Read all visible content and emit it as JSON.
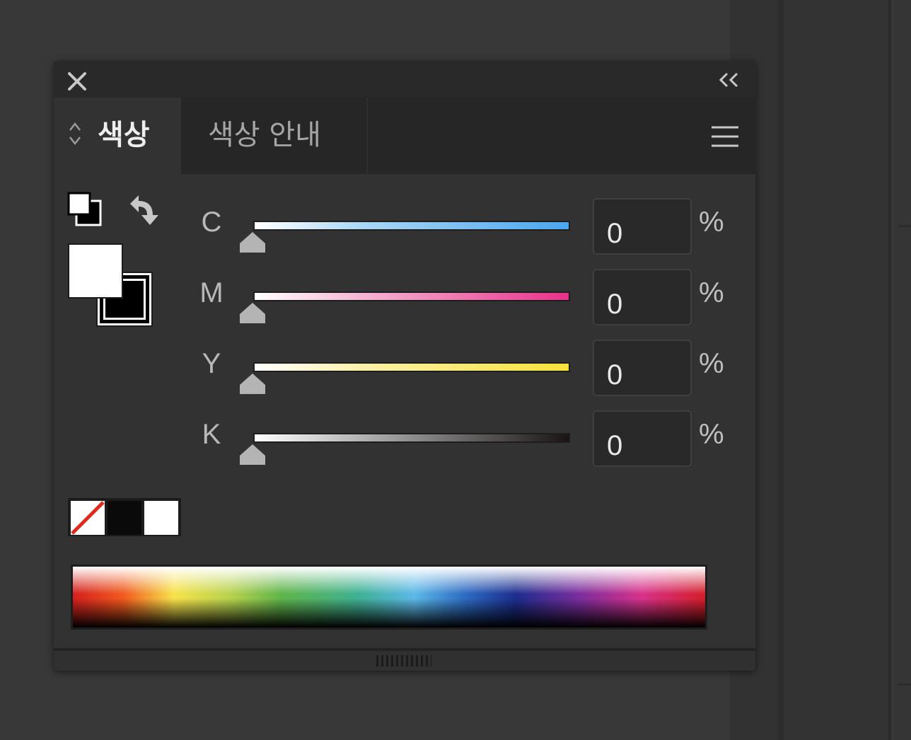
{
  "panel": {
    "tabs": [
      {
        "label": "색상",
        "active": true
      },
      {
        "label": "색상 안내",
        "active": false
      }
    ],
    "collapse_glyph": "<<"
  },
  "colors": {
    "accent_cyan": "#4aa6f0",
    "accent_magenta": "#e8318a",
    "accent_yellow": "#f7e23a",
    "panel_bg": "#323232",
    "fill": "#ffffff",
    "stroke": "#000000"
  },
  "channels": [
    {
      "letter": "C",
      "value": "0",
      "unit": "%"
    },
    {
      "letter": "M",
      "value": "0",
      "unit": "%"
    },
    {
      "letter": "Y",
      "value": "0",
      "unit": "%"
    },
    {
      "letter": "K",
      "value": "0",
      "unit": "%"
    }
  ],
  "quick_swatches": [
    "none",
    "black",
    "white"
  ],
  "icons": [
    "close-icon",
    "collapse-icon",
    "updown-icon",
    "menu-icon",
    "default-fill-stroke-icon",
    "swap-fill-stroke-icon"
  ]
}
